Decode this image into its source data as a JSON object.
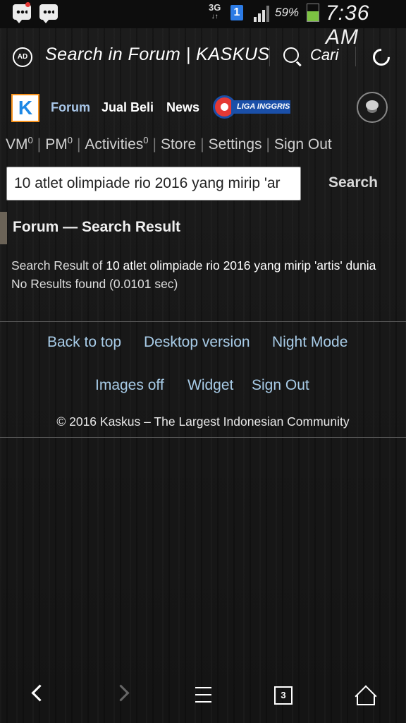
{
  "status_bar": {
    "network": "3G",
    "network_arrows": "↓↑",
    "sim": "1",
    "battery": "59%",
    "battery_level": 0.59,
    "time": "7:36 AM",
    "icons": [
      "bbm-icon",
      "bbm-icon",
      "signal-icon",
      "battery-icon"
    ]
  },
  "app_bar": {
    "ad_icon": "AD",
    "title": "Search in Forum | KASKUS",
    "search_label": "Cari"
  },
  "site_nav": {
    "logo": "K",
    "links": [
      "Forum",
      "Jual Beli",
      "News"
    ],
    "liga_label": "LIGA INGGRIS"
  },
  "user_menu": {
    "items": [
      {
        "label": "VM",
        "count": "0"
      },
      {
        "label": "PM",
        "count": "0"
      },
      {
        "label": "Activities",
        "count": "0"
      },
      {
        "label": "Store"
      },
      {
        "label": "Settings"
      },
      {
        "label": "Sign Out"
      }
    ]
  },
  "search": {
    "value": "10 atlet olimpiade rio 2016 yang mirip 'ar",
    "button": "Search"
  },
  "result": {
    "section_title": "Forum — Search Result",
    "prefix": "Search Result of ",
    "query": "10 atlet olimpiade rio 2016 yang mirip 'artis' dunia",
    "suffix": " No Results found (0.0101 sec)"
  },
  "footer": {
    "back_to_top": "Back to top",
    "desktop_version": "Desktop version",
    "night_mode": "Night Mode",
    "images_off": "Images off",
    "widget": "Widget",
    "sign_out": "Sign Out",
    "copyright": "© 2016 Kaskus – The Largest Indonesian Community"
  },
  "browser_nav": {
    "tab_count": "3"
  }
}
